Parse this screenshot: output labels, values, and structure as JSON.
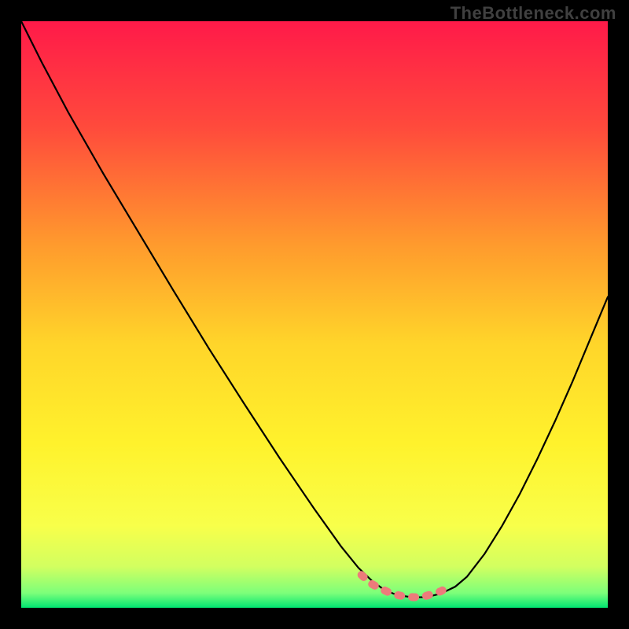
{
  "watermark": "TheBottleneck.com",
  "chart_data": {
    "type": "line",
    "title": "",
    "xlabel": "",
    "ylabel": "",
    "xlim": [
      0,
      100
    ],
    "ylim": [
      0,
      100
    ],
    "gradient_stops": [
      {
        "offset": 0.0,
        "color": "#ff1a49"
      },
      {
        "offset": 0.18,
        "color": "#ff4a3c"
      },
      {
        "offset": 0.38,
        "color": "#ff9a2d"
      },
      {
        "offset": 0.55,
        "color": "#ffd52a"
      },
      {
        "offset": 0.72,
        "color": "#fff22c"
      },
      {
        "offset": 0.86,
        "color": "#f8ff4a"
      },
      {
        "offset": 0.93,
        "color": "#d2ff60"
      },
      {
        "offset": 0.975,
        "color": "#7cff7a"
      },
      {
        "offset": 1.0,
        "color": "#00e572"
      }
    ],
    "series": [
      {
        "name": "bottleneck-curve",
        "color": "#000000",
        "x": [
          0.0,
          3.5,
          8.0,
          14.0,
          20.0,
          26.0,
          32.0,
          38.0,
          44.0,
          50.0,
          54.5,
          57.5,
          60.0,
          62.0,
          64.0,
          66.5,
          69.0,
          71.5,
          74.0,
          76.0,
          79.0,
          82.0,
          85.0,
          88.0,
          91.0,
          94.0,
          97.0,
          100.0
        ],
        "y": [
          100.0,
          93.0,
          84.5,
          74.0,
          64.0,
          54.0,
          44.2,
          34.8,
          25.6,
          16.8,
          10.5,
          6.8,
          4.4,
          3.0,
          2.2,
          1.8,
          1.8,
          2.4,
          3.6,
          5.3,
          9.2,
          14.0,
          19.4,
          25.4,
          31.8,
          38.6,
          45.8,
          53.0
        ]
      },
      {
        "name": "solution-segment",
        "color": "#ed7b7b",
        "x": [
          58.0,
          59.5,
          61.0,
          62.5,
          64.0,
          65.5,
          67.0,
          68.5,
          70.0,
          71.5,
          73.0
        ],
        "y": [
          5.6,
          4.2,
          3.4,
          2.7,
          2.2,
          1.9,
          1.8,
          1.9,
          2.3,
          2.8,
          3.6
        ]
      }
    ]
  }
}
